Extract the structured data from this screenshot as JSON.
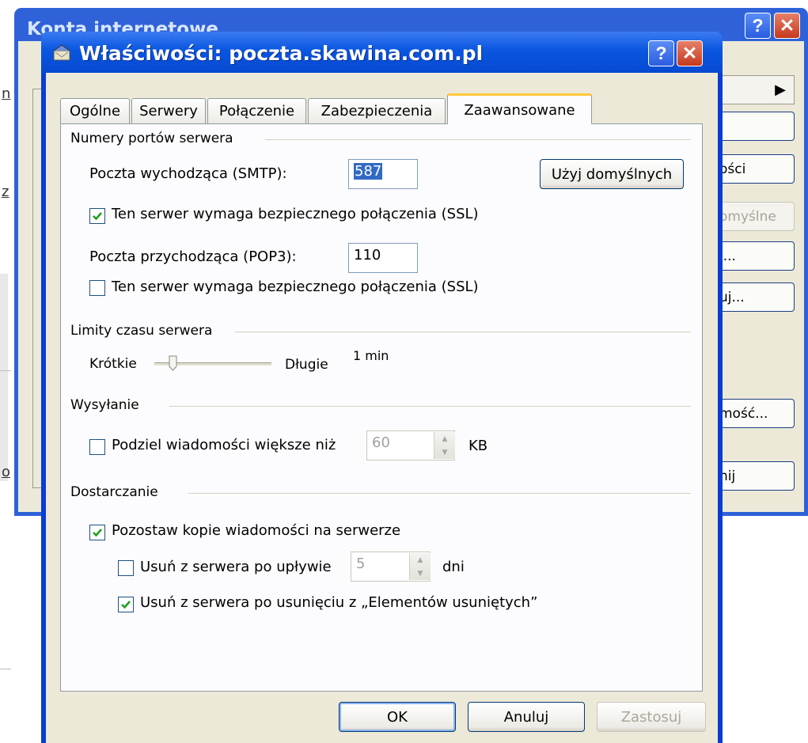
{
  "back_window": {
    "title": "Konta internetowe",
    "buttons": [
      "",
      "",
      "ości",
      "omyślne",
      "j...",
      "uj...",
      "mość...",
      "nij"
    ]
  },
  "background": {
    "glyphs": [
      "n",
      "z",
      "o"
    ]
  },
  "dialog": {
    "title": "Właściwości: poczta.skawina.com.pl",
    "tabs": [
      "Ogólne",
      "Serwery",
      "Połączenie",
      "Zabezpieczenia",
      "Zaawansowane"
    ],
    "active_tab": "Zaawansowane",
    "ports": {
      "group_label": "Numery portów serwera",
      "smtp_label": "Poczta wychodząca (SMTP):",
      "smtp_value": "587",
      "use_defaults_label": "Użyj domyślnych",
      "smtp_ssl_label": "Ten serwer wymaga bezpiecznego połączenia (SSL)",
      "pop3_label": "Poczta przychodząca (POP3):",
      "pop3_value": "110",
      "pop3_ssl_label": "Ten serwer wymaga bezpiecznego połączenia (SSL)"
    },
    "timeouts": {
      "group_label": "Limity czasu serwera",
      "short_label": "Krótkie",
      "long_label": "Długie",
      "value_label": "1 min"
    },
    "sending": {
      "group_label": "Wysyłanie",
      "split_label": "Podziel wiadomości większe niż",
      "split_value": "60",
      "unit": "KB"
    },
    "delivery": {
      "group_label": "Dostarczanie",
      "keep_copy_label": "Pozostaw kopie wiadomości na serwerze",
      "remove_after_label": "Usuń z serwera po upływie",
      "remove_after_value": "5",
      "remove_after_unit": "dni",
      "remove_deleted_label": "Usuń z serwera po usunięciu z „Elementów usuniętych”"
    },
    "footer": {
      "ok_label": "OK",
      "cancel_label": "Anuluj",
      "apply_label": "Zastosuj"
    }
  },
  "state": {
    "smtp_ssl_checked": true,
    "pop3_ssl_checked": false,
    "split_checked": false,
    "keep_copy_checked": true,
    "remove_after_checked": false,
    "remove_deleted_checked": true,
    "timeout_level": 0.1
  },
  "colors": {
    "titlebar": "#0a56e0",
    "dialog_face": "#ece9d8",
    "check_green": "#21a121",
    "selection": "#316ac5"
  }
}
